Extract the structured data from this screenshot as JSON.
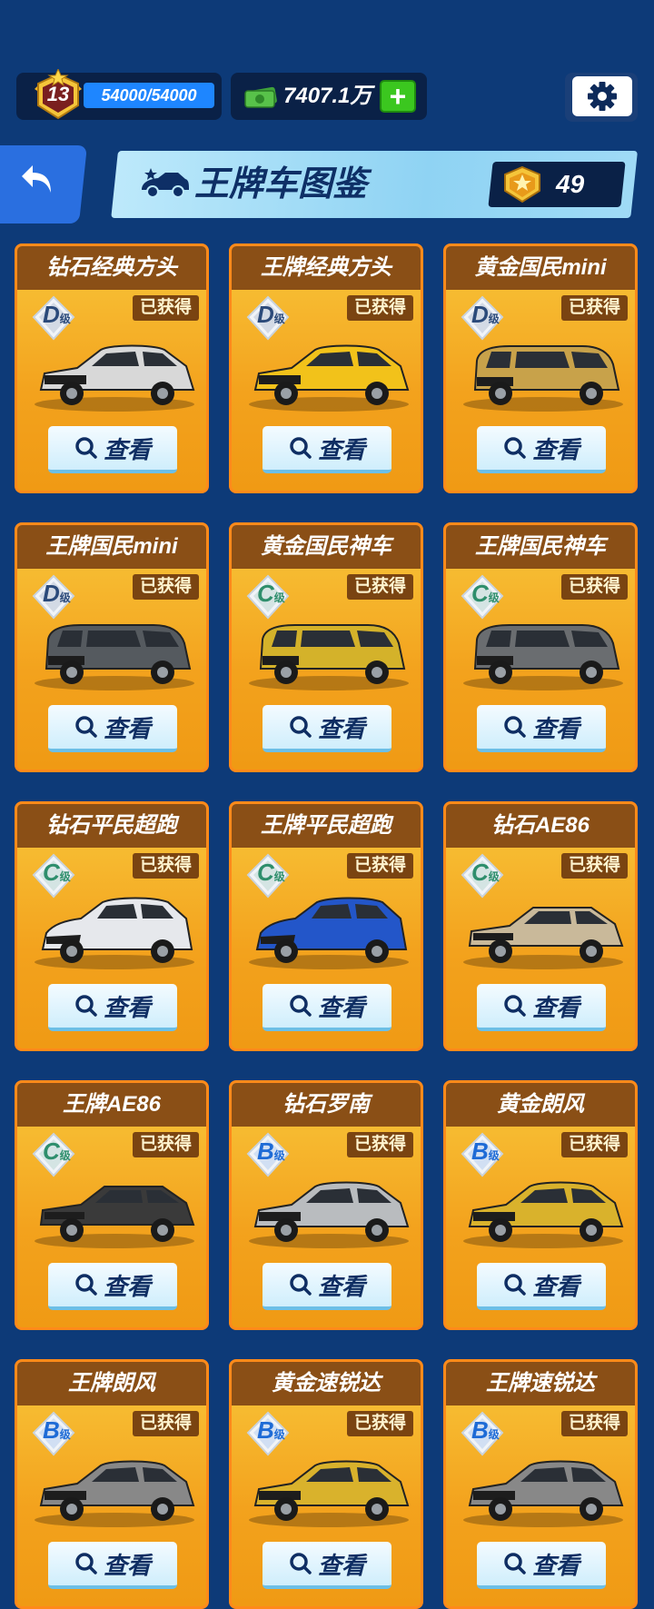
{
  "topbar": {
    "level": "13",
    "xp": "54000/54000",
    "xp_progress": 1.0,
    "money": "7407.1万",
    "plus": "+"
  },
  "header": {
    "title": "王牌车图鉴",
    "medal_count": "49"
  },
  "colors": {
    "background": "#0d3a78",
    "card_orange": "#f3a21d",
    "card_title_bg": "#8a4f16",
    "grade_D": "#2b4a7a",
    "grade_C": "#2e8e6c",
    "grade_B": "#1e6bd6"
  },
  "cards": [
    {
      "title": "钻石经典方头",
      "grade": "D",
      "grade_suffix": "级",
      "status": "已获得",
      "view": "查看",
      "car_color": "#d8d8d8",
      "car_style": "sedan"
    },
    {
      "title": "王牌经典方头",
      "grade": "D",
      "grade_suffix": "级",
      "status": "已获得",
      "view": "查看",
      "car_color": "#f2c21a",
      "car_style": "sedan"
    },
    {
      "title": "黄金国民mini",
      "grade": "D",
      "grade_suffix": "级",
      "status": "已获得",
      "view": "查看",
      "car_color": "#c8a24a",
      "car_style": "mini"
    },
    {
      "title": "王牌国民mini",
      "grade": "D",
      "grade_suffix": "级",
      "status": "已获得",
      "view": "查看",
      "car_color": "#555a5f",
      "car_style": "mini"
    },
    {
      "title": "黄金国民神车",
      "grade": "C",
      "grade_suffix": "级",
      "status": "已获得",
      "view": "查看",
      "car_color": "#d4b22a",
      "car_style": "van"
    },
    {
      "title": "王牌国民神车",
      "grade": "C",
      "grade_suffix": "级",
      "status": "已获得",
      "view": "查看",
      "car_color": "#6a6d70",
      "car_style": "van"
    },
    {
      "title": "钻石平民超跑",
      "grade": "C",
      "grade_suffix": "级",
      "status": "已获得",
      "view": "查看",
      "car_color": "#e6e8ec",
      "car_style": "hatch"
    },
    {
      "title": "王牌平民超跑",
      "grade": "C",
      "grade_suffix": "级",
      "status": "已获得",
      "view": "查看",
      "car_color": "#2356c9",
      "car_style": "hatch"
    },
    {
      "title": "钻石AE86",
      "grade": "C",
      "grade_suffix": "级",
      "status": "已获得",
      "view": "查看",
      "car_color": "#c9b99a",
      "car_style": "coupe"
    },
    {
      "title": "王牌AE86",
      "grade": "C",
      "grade_suffix": "级",
      "status": "已获得",
      "view": "查看",
      "car_color": "#3a3a3a",
      "car_style": "coupe"
    },
    {
      "title": "钻石罗南",
      "grade": "B",
      "grade_suffix": "级",
      "status": "已获得",
      "view": "查看",
      "car_color": "#b9bcbf",
      "car_style": "sedan2"
    },
    {
      "title": "黄金朗风",
      "grade": "B",
      "grade_suffix": "级",
      "status": "已获得",
      "view": "查看",
      "car_color": "#d9b22c",
      "car_style": "sedan2"
    },
    {
      "title": "王牌朗风",
      "grade": "B",
      "grade_suffix": "级",
      "status": "已获得",
      "view": "查看",
      "car_color": "#888888",
      "car_style": "sedan2"
    },
    {
      "title": "黄金速锐达",
      "grade": "B",
      "grade_suffix": "级",
      "status": "已获得",
      "view": "查看",
      "car_color": "#d9b22c",
      "car_style": "sedan2"
    },
    {
      "title": "王牌速锐达",
      "grade": "B",
      "grade_suffix": "级",
      "status": "已获得",
      "view": "查看",
      "car_color": "#888888",
      "car_style": "sedan2"
    }
  ]
}
